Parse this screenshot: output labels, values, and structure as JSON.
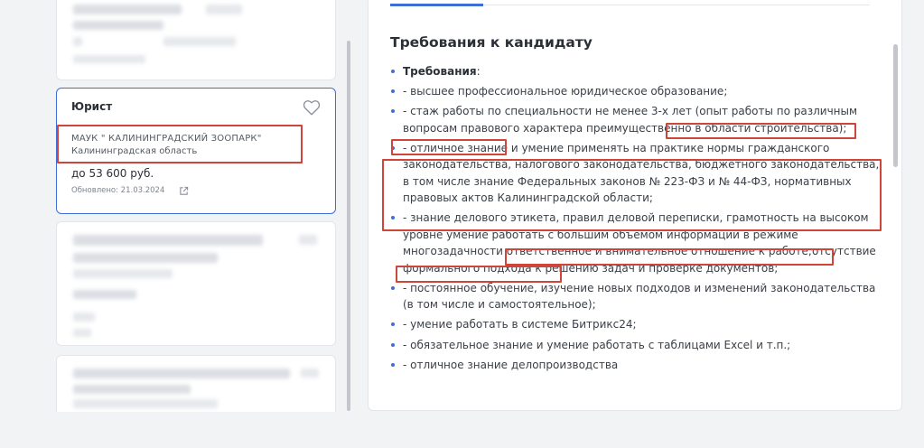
{
  "selected_card": {
    "title": "Юрист",
    "employer": "МАУК \" КАЛИНИНГРАДСКИЙ ЗООПАРК\"",
    "region": "Калининградская область",
    "salary": "до 53 600 руб.",
    "updated": "Обновлено: 21.03.2024",
    "heart_icon": "heart-outline-icon",
    "external_icon": "external-link-icon"
  },
  "requirements": {
    "title": "Требования к кандидату",
    "heading": "Требования",
    "heading_suffix": ":",
    "items": [
      "- высшее профессиональное юридическое образование;",
      "- стаж работы по специальности не менее 3-х лет (опыт работы по различным вопросам правового характера преимущественно в области строительства);",
      "- отличное знание и умение применять на практике нормы гражданского законодательства, налогового законодательства, бюджетного законодательства, в том числе знание Федеральных законов № 223-ФЗ и № 44-ФЗ, нормативных правовых актов Калининградской области;",
      "- знание делового этикета, правил деловой переписки, грамотность на высоком уровне умение работать с большим объемом информации в режиме многозадачности ответственное и внимательное отношение к работе;отсутствие формального подхода к решению задач и проверке документов;",
      "- постоянное обучение, изучение новых подходов и изменений законодательства (в том числе и самостоятельное);",
      "- умение работать в системе Битрикс24;",
      "- обязательное знание и умение работать с таблицами Excel и т.п.;",
      "- отличное знание делопроизводства"
    ]
  },
  "colors": {
    "accent": "#3d6fd6",
    "highlight": "#d0453a"
  }
}
